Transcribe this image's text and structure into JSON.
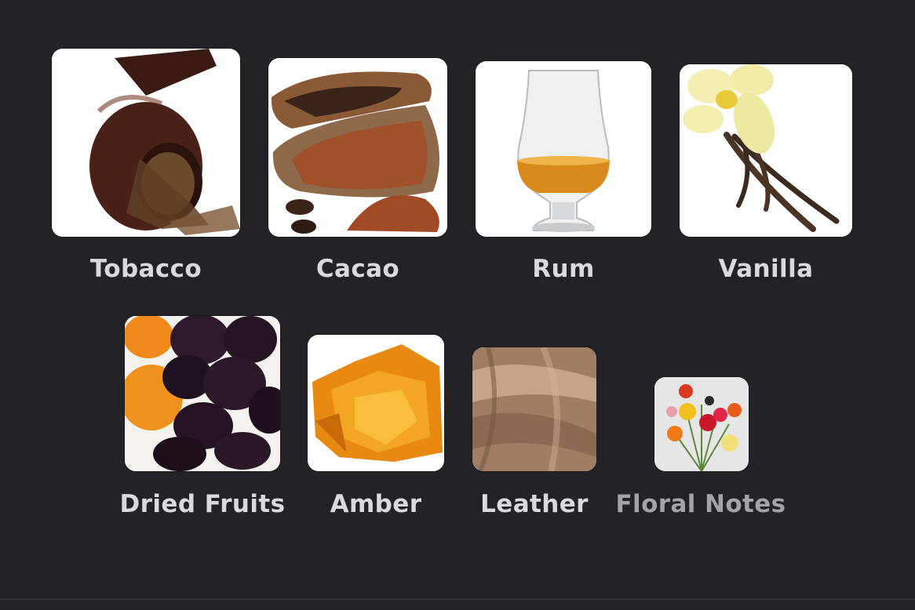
{
  "notes": [
    {
      "label": "Tobacco",
      "icon": "tobacco-pipe-image",
      "selected": true
    },
    {
      "label": "Cacao",
      "icon": "cacao-pod-image",
      "selected": true
    },
    {
      "label": "Rum",
      "icon": "rum-glass-image",
      "selected": true
    },
    {
      "label": "Vanilla",
      "icon": "vanilla-flower-image",
      "selected": true
    },
    {
      "label": "Dried Fruits",
      "icon": "dried-fruits-image",
      "selected": true
    },
    {
      "label": "Amber",
      "icon": "amber-resin-image",
      "selected": true
    },
    {
      "label": "Leather",
      "icon": "leather-image",
      "selected": true
    },
    {
      "label": "Floral Notes",
      "icon": "floral-bouquet-image",
      "selected": false
    }
  ],
  "colors": {
    "background": "#232227",
    "label": "#d9d9de",
    "label_dim": "#a3a3aa"
  }
}
